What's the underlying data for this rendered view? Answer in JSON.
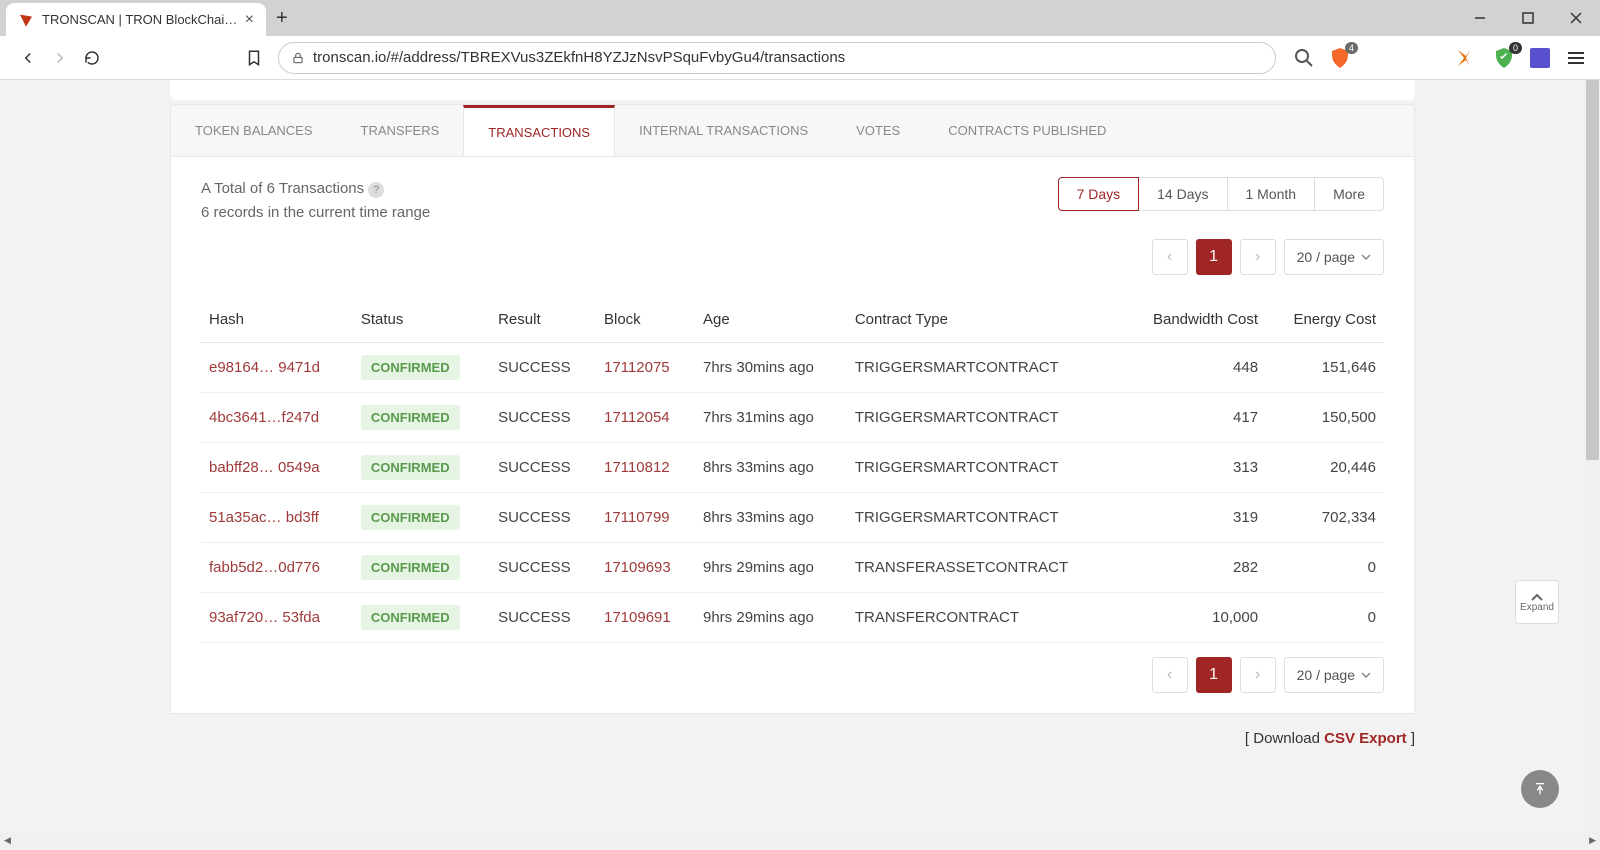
{
  "browser": {
    "tab_title": "TRONSCAN | TRON BlockChain Ex",
    "url": "tronscan.io/#/address/TBREXVus3ZEkfnH8YZJzNsvPSquFvbyGu4/transactions",
    "brave_count": "4",
    "shield_count": "0"
  },
  "tabs": {
    "items": [
      "TOKEN BALANCES",
      "TRANSFERS",
      "TRANSACTIONS",
      "INTERNAL TRANSACTIONS",
      "VOTES",
      "CONTRACTS PUBLISHED"
    ],
    "active_index": 2
  },
  "summary": {
    "total": "A Total of 6 Transactions",
    "range": "6 records in the current time range"
  },
  "range_buttons": [
    "7 Days",
    "14 Days",
    "1 Month",
    "More"
  ],
  "pager": {
    "current": "1",
    "page_size": "20 / page"
  },
  "table": {
    "headers": [
      "Hash",
      "Status",
      "Result",
      "Block",
      "Age",
      "Contract Type",
      "Bandwidth Cost",
      "Energy Cost"
    ],
    "rows": [
      {
        "hash": "e98164… 9471d",
        "status": "CONFIRMED",
        "result": "SUCCESS",
        "block": "17112075",
        "age": "7hrs 30mins ago",
        "contract": "TRIGGERSMARTCONTRACT",
        "bandwidth": "448",
        "energy": "151,646"
      },
      {
        "hash": "4bc3641…f247d",
        "status": "CONFIRMED",
        "result": "SUCCESS",
        "block": "17112054",
        "age": "7hrs 31mins ago",
        "contract": "TRIGGERSMARTCONTRACT",
        "bandwidth": "417",
        "energy": "150,500"
      },
      {
        "hash": "babff28… 0549a",
        "status": "CONFIRMED",
        "result": "SUCCESS",
        "block": "17110812",
        "age": "8hrs 33mins ago",
        "contract": "TRIGGERSMARTCONTRACT",
        "bandwidth": "313",
        "energy": "20,446"
      },
      {
        "hash": "51a35ac… bd3ff",
        "status": "CONFIRMED",
        "result": "SUCCESS",
        "block": "17110799",
        "age": "8hrs 33mins ago",
        "contract": "TRIGGERSMARTCONTRACT",
        "bandwidth": "319",
        "energy": "702,334"
      },
      {
        "hash": "fabb5d2…0d776",
        "status": "CONFIRMED",
        "result": "SUCCESS",
        "block": "17109693",
        "age": "9hrs 29mins ago",
        "contract": "TRANSFERASSETCONTRACT",
        "bandwidth": "282",
        "energy": "0"
      },
      {
        "hash": "93af720… 53fda",
        "status": "CONFIRMED",
        "result": "SUCCESS",
        "block": "17109691",
        "age": "9hrs 29mins ago",
        "contract": "TRANSFERCONTRACT",
        "bandwidth": "10,000",
        "energy": "0"
      }
    ]
  },
  "download": {
    "prefix": "[ Download ",
    "csv": "CSV Export",
    "suffix": "  ]"
  },
  "expand": "Expand"
}
